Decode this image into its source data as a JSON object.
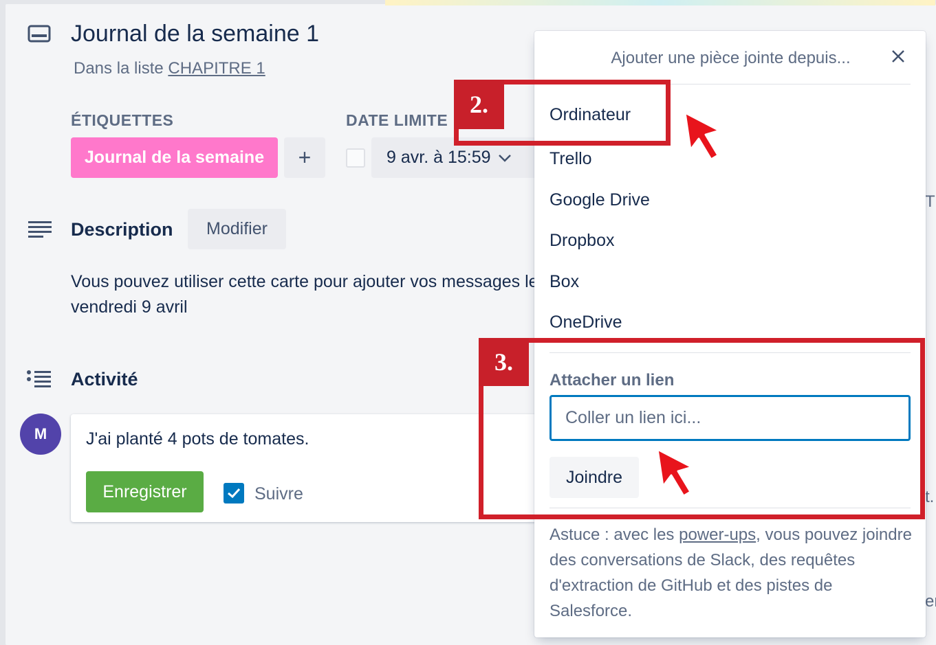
{
  "card": {
    "title": "Journal de la semaine 1",
    "subtitle_prefix": "Dans la liste ",
    "list_link": "CHAPITRE 1"
  },
  "labels": {
    "section": "ÉTIQUETTES",
    "pill": "Journal de la semaine",
    "add": "+"
  },
  "due": {
    "section": "DATE LIMITE",
    "value": "9 avr. à 15:59"
  },
  "description": {
    "title": "Description",
    "modify": "Modifier",
    "text": "Vous pouvez utiliser cette carte pour ajouter vos messages le vendredi 9 avril"
  },
  "activity": {
    "title": "Activité",
    "avatar_initial": "M",
    "comment": "J'ai planté 4 pots de tomates.",
    "save": "Enregistrer",
    "follow": "Suivre",
    "follow_checked": true
  },
  "popover": {
    "title": "Ajouter une pièce jointe depuis...",
    "items": [
      "Ordinateur",
      "Trello",
      "Google Drive",
      "Dropbox",
      "Box",
      "OneDrive"
    ],
    "link_section": "Attacher un lien",
    "link_placeholder": "Coller un lien ici...",
    "join": "Joindre",
    "tip_prefix": "Astuce : avec les ",
    "tip_link": "power-ups",
    "tip_suffix": ", vous pouvez joindre des conversations de Slack, des requêtes d'extraction de GitHub et des pistes de Salesforce."
  },
  "annotations": {
    "step2": "2.",
    "step3": "3."
  },
  "edge_fragments": {
    "e1": "TE",
    "e2": "t.",
    "e3": "er"
  },
  "colors": {
    "label_pink": "#ff78cb",
    "save_green": "#5aac44",
    "accent_blue": "#0079bf",
    "annotation_red": "#d0202a",
    "avatar_purple": "#5243aa"
  }
}
